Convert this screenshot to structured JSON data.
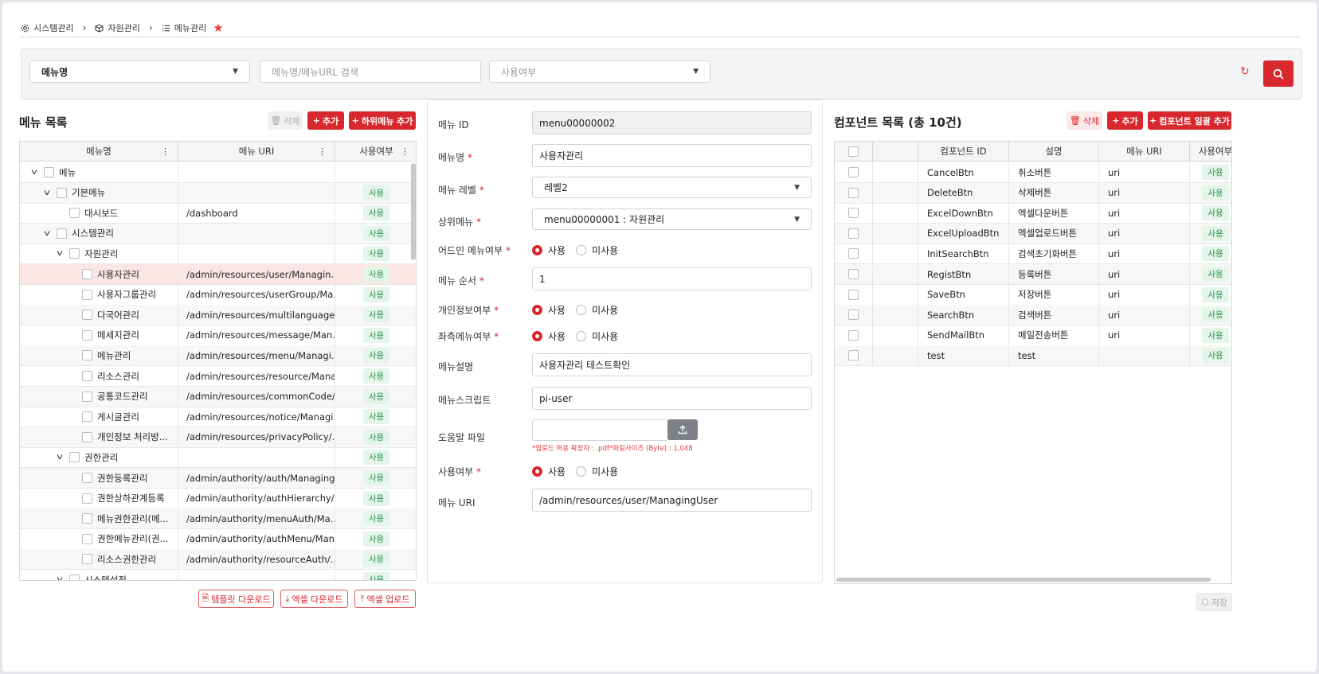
{
  "breadcrumb": {
    "items": [
      "시스템관리",
      "자원관리",
      "메뉴관리"
    ]
  },
  "search": {
    "field_select": "메뉴명",
    "keyword_placeholder": "메뉴명/메뉴URL 검색",
    "use_select_placeholder": "사용여부"
  },
  "menu_list": {
    "title": "메뉴 목록",
    "delete_label": "삭제",
    "add_label": "추가",
    "add_sub_label": "하위메뉴 추가",
    "columns": [
      "메뉴명",
      "메뉴 URI",
      "사용여부"
    ],
    "rows": [
      {
        "name": "메뉴",
        "uri": "",
        "use": "",
        "toggle": "v"
      },
      {
        "name": "기본메뉴",
        "uri": "",
        "use": "사용",
        "toggle": "v"
      },
      {
        "name": "대시보드",
        "uri": "/dashboard",
        "use": "사용",
        "toggle": ""
      },
      {
        "name": "시스템관리",
        "uri": "",
        "use": "사용",
        "toggle": "v"
      },
      {
        "name": "자원관리",
        "uri": "",
        "use": "사용",
        "toggle": "v"
      },
      {
        "name": "사용자관리",
        "uri": "/admin/resources/user/Managin...",
        "use": "사용",
        "toggle": ""
      },
      {
        "name": "사용자그룹관리",
        "uri": "/admin/resources/userGroup/Ma...",
        "use": "사용",
        "toggle": ""
      },
      {
        "name": "다국어관리",
        "uri": "/admin/resources/multilanguage...",
        "use": "사용",
        "toggle": ""
      },
      {
        "name": "메세지관리",
        "uri": "/admin/resources/message/Man...",
        "use": "사용",
        "toggle": ""
      },
      {
        "name": "메뉴관리",
        "uri": "/admin/resources/menu/Managi...",
        "use": "사용",
        "toggle": ""
      },
      {
        "name": "리소스관리",
        "uri": "/admin/resources/resource/Mana...",
        "use": "사용",
        "toggle": ""
      },
      {
        "name": "공통코드관리",
        "uri": "/admin/resources/commonCode/...",
        "use": "사용",
        "toggle": ""
      },
      {
        "name": "게시글관리",
        "uri": "/admin/resources/notice/Managi...",
        "use": "사용",
        "toggle": ""
      },
      {
        "name": "개인정보 처리방...",
        "uri": "/admin/resources/privacyPolicy/...",
        "use": "사용",
        "toggle": ""
      },
      {
        "name": "권한관리",
        "uri": "",
        "use": "사용",
        "toggle": "v"
      },
      {
        "name": "권한등록관리",
        "uri": "/admin/authority/auth/Managing...",
        "use": "사용",
        "toggle": ""
      },
      {
        "name": "권한상하관계등록",
        "uri": "/admin/authority/authHierarchy/...",
        "use": "사용",
        "toggle": ""
      },
      {
        "name": "메뉴권한관리(메...",
        "uri": "/admin/authority/menuAuth/Ma...",
        "use": "사용",
        "toggle": ""
      },
      {
        "name": "권한메뉴관리(권...",
        "uri": "/admin/authority/authMenu/Man...",
        "use": "사용",
        "toggle": ""
      },
      {
        "name": "리소스권한관리",
        "uri": "/admin/authority/resourceAuth/...",
        "use": "사용",
        "toggle": ""
      },
      {
        "name": "시스템설정",
        "uri": "",
        "use": "사용",
        "toggle": "v"
      }
    ],
    "template_download": "템플릿 다운로드",
    "excel_download": "엑셀 다운로드",
    "excel_upload": "엑셀 업로드"
  },
  "detail": {
    "menu_id_label": "메뉴 ID",
    "menu_id": "menu00000002",
    "menu_name_label": "메뉴명",
    "menu_name": "사용자관리",
    "menu_level_label": "메뉴 레벨",
    "menu_level": "레벨2",
    "parent_label": "상위메뉴",
    "parent": "menu00000001 : 자원관리",
    "admin_label": "어드민 메뉴여부",
    "order_label": "메뉴 순서",
    "order": "1",
    "privacy_label": "개인정보여부",
    "left_label": "좌측메뉴여부",
    "desc_label": "메뉴설명",
    "desc": "사용자관리 테스트확인",
    "script_label": "메뉴스크립트",
    "script": "pi-user",
    "help_label": "도움말 파일",
    "help_hint": "*업로드 허용 확장자 : .pdf*파일사이즈 (Byte) : 1,048",
    "use_label": "사용여부",
    "uri_label": "메뉴 URI",
    "uri": "/admin/resources/user/ManagingUser",
    "opt_use": "사용",
    "opt_unuse": "미사용",
    "req": "*"
  },
  "components": {
    "title": "컴포넌트 목록 (총 10건)",
    "delete_label": "삭제",
    "add_label": "추가",
    "bulk_add_label": "컴포넌트 일괄 추가",
    "columns": [
      "컴포넌트 ID",
      "설명",
      "메뉴 URI",
      "사용여부"
    ],
    "rows": [
      {
        "id": "CancelBtn",
        "desc": "취소버튼",
        "uri": "uri",
        "use": "사용"
      },
      {
        "id": "DeleteBtn",
        "desc": "삭제버튼",
        "uri": "uri",
        "use": "사용"
      },
      {
        "id": "ExcelDownBtn",
        "desc": "엑셀다운버튼",
        "uri": "uri",
        "use": "사용"
      },
      {
        "id": "ExcelUploadBtn",
        "desc": "엑셀업로드버튼",
        "uri": "uri",
        "use": "사용"
      },
      {
        "id": "InitSearchBtn",
        "desc": "검색초기화버튼",
        "uri": "uri",
        "use": "사용"
      },
      {
        "id": "RegistBtn",
        "desc": "등록버튼",
        "uri": "uri",
        "use": "사용"
      },
      {
        "id": "SaveBtn",
        "desc": "저장버튼",
        "uri": "uri",
        "use": "사용"
      },
      {
        "id": "SearchBtn",
        "desc": "검색버튼",
        "uri": "uri",
        "use": "사용"
      },
      {
        "id": "SendMailBtn",
        "desc": "메일전송버튼",
        "uri": "uri",
        "use": "사용"
      },
      {
        "id": "test",
        "desc": "test",
        "uri": "",
        "use": "사용"
      }
    ],
    "save_label": "저장"
  },
  "colors": {
    "accent": "#d8282e",
    "badge_bg": "#e4f5e9",
    "badge_text": "#2f8f4e"
  }
}
